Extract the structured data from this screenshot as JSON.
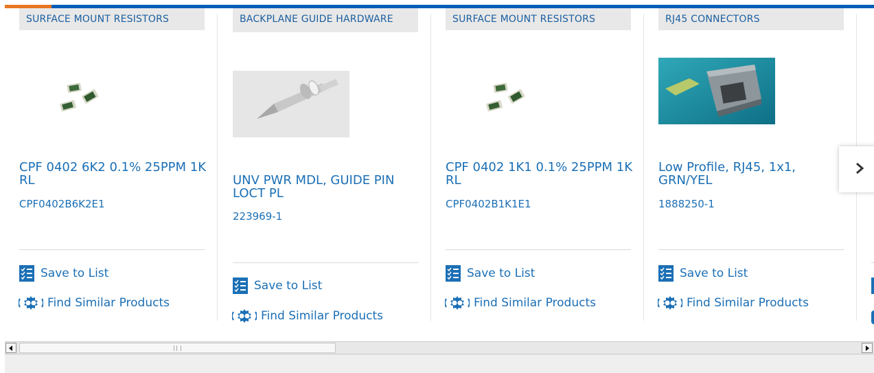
{
  "colors": {
    "primary": "#005eb8",
    "accent": "#e87722",
    "link": "#1b6fb5"
  },
  "cards": [
    {
      "category": "SURFACE MOUNT RESISTORS",
      "title": "CPF 0402 6K2 0.1% 25PPM 1K RL",
      "part_number": "CPF0402B6K2E1",
      "image": "smd-resistors",
      "save_label": "Save to List",
      "similar_label": "Find Similar Products"
    },
    {
      "category": "BACKPLANE GUIDE HARDWARE",
      "title": "UNV PWR MDL, GUIDE PIN LOCT PL",
      "part_number": "223969-1",
      "image": "guide-pin",
      "save_label": "Save to List",
      "similar_label": "Find Similar Products"
    },
    {
      "category": "SURFACE MOUNT RESISTORS",
      "title": "CPF 0402 1K1 0.1% 25PPM 1K RL",
      "part_number": "CPF0402B1K1E1",
      "image": "smd-resistors",
      "save_label": "Save to List",
      "similar_label": "Find Similar Products"
    },
    {
      "category": "RJ45 CONNECTORS",
      "title": "Low Profile, RJ45, 1x1, GRN/YEL",
      "part_number": "1888250-1",
      "image": "rj45-connector",
      "save_label": "Save to List",
      "similar_label": "Find Similar Products"
    }
  ],
  "next_button": {
    "icon": "chevron-right-icon"
  },
  "scrollbar": {
    "left_icon": "arrow-left-icon",
    "right_icon": "arrow-right-icon"
  }
}
